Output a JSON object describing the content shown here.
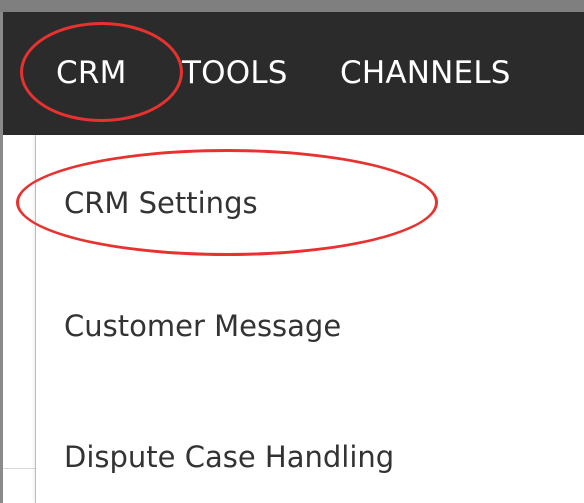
{
  "nav": {
    "items": [
      {
        "label": "CRM",
        "selected": true
      },
      {
        "label": "TOOLS",
        "selected": false
      },
      {
        "label": "CHANNELS",
        "selected": false
      }
    ]
  },
  "dropdown": {
    "items": [
      {
        "label": "CRM Settings",
        "highlighted": true
      },
      {
        "label": "Customer Message",
        "highlighted": false
      },
      {
        "label": "Dispute Case Handling",
        "highlighted": false
      }
    ]
  },
  "colors": {
    "navbar": "#2b2b2b",
    "nav_text": "#ffffff",
    "menu_text": "#333333",
    "annotation": "#e8322f"
  }
}
